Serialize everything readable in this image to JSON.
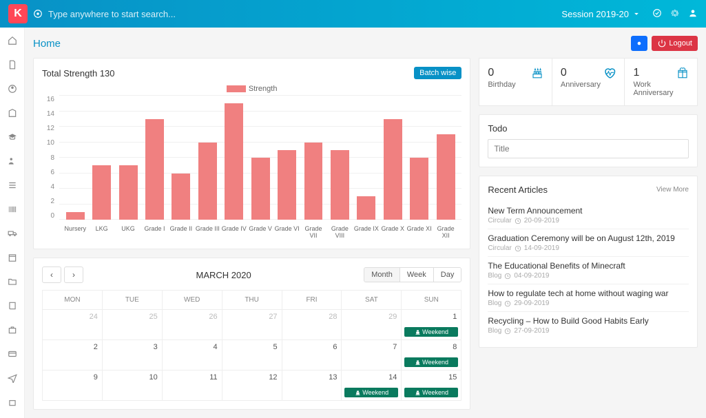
{
  "header": {
    "logo_letter": "K",
    "search_placeholder": "Type anywhere to start search...",
    "session_label": "Session 2019-20"
  },
  "breadcrumb": {
    "title": "Home",
    "logout_label": "Logout"
  },
  "chart_card": {
    "title": "Total Strength 130",
    "batch_btn": "Batch wise",
    "legend_label": "Strength"
  },
  "chart_data": {
    "type": "bar",
    "title": "Total Strength 130",
    "categories": [
      "Nursery",
      "LKG",
      "UKG",
      "Grade I",
      "Grade II",
      "Grade III",
      "Grade IV",
      "Grade V",
      "Grade VI",
      "Grade VII",
      "Grade VIII",
      "Grade IX",
      "Grade X",
      "Grade XI",
      "Grade XII"
    ],
    "values": [
      1,
      7,
      7,
      13,
      6,
      10,
      15,
      8,
      9,
      10,
      9,
      3,
      13,
      8,
      11
    ],
    "ylabel": "",
    "xlabel": "",
    "ylim": [
      0,
      16
    ],
    "y_ticks": [
      16,
      14,
      12,
      10,
      8,
      6,
      4,
      2,
      0
    ],
    "series_name": "Strength"
  },
  "calendar": {
    "title": "MARCH 2020",
    "view_month": "Month",
    "view_week": "Week",
    "view_day": "Day",
    "weekdays": [
      "MON",
      "TUE",
      "WED",
      "THU",
      "FRI",
      "SAT",
      "SUN"
    ],
    "weeks": [
      [
        {
          "d": "24",
          "other": true
        },
        {
          "d": "25",
          "other": true
        },
        {
          "d": "26",
          "other": true
        },
        {
          "d": "27",
          "other": true
        },
        {
          "d": "28",
          "other": true
        },
        {
          "d": "29",
          "other": true
        },
        {
          "d": "1",
          "events": [
            "Weekend"
          ]
        }
      ],
      [
        {
          "d": "2"
        },
        {
          "d": "3"
        },
        {
          "d": "4"
        },
        {
          "d": "5"
        },
        {
          "d": "6"
        },
        {
          "d": "7"
        },
        {
          "d": "8",
          "events": [
            "Weekend"
          ]
        }
      ],
      [
        {
          "d": "9"
        },
        {
          "d": "10"
        },
        {
          "d": "11"
        },
        {
          "d": "12"
        },
        {
          "d": "13"
        },
        {
          "d": "14",
          "events": [
            "Weekend"
          ]
        },
        {
          "d": "15",
          "events": [
            "Weekend"
          ]
        }
      ]
    ],
    "event_label": "Weekend"
  },
  "stats": {
    "birthday": {
      "value": "0",
      "label": "Birthday"
    },
    "anniversary": {
      "value": "0",
      "label": "Anniversary"
    },
    "work_anniversary": {
      "value": "1",
      "label": "Work Anniversary"
    }
  },
  "todo": {
    "heading": "Todo",
    "placeholder": "Title"
  },
  "articles": {
    "heading": "Recent Articles",
    "view_more": "View More",
    "items": [
      {
        "title": "New Term Announcement",
        "type": "Circular",
        "date": "20-09-2019"
      },
      {
        "title": "Graduation Ceremony will be on August 12th, 2019",
        "type": "Circular",
        "date": "14-09-2019"
      },
      {
        "title": "The Educational Benefits of Minecraft",
        "type": "Blog",
        "date": "04-09-2019"
      },
      {
        "title": "How to regulate tech at home without waging war",
        "type": "Blog",
        "date": "29-09-2019"
      },
      {
        "title": "Recycling – How to Build Good Habits Early",
        "type": "Blog",
        "date": "27-09-2019"
      }
    ]
  }
}
